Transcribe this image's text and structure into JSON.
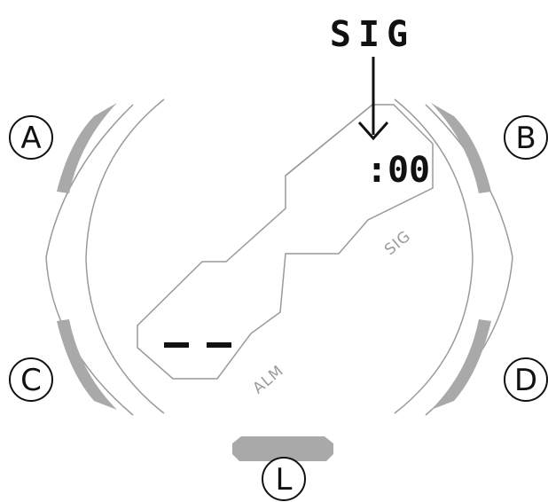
{
  "callout": {
    "label": "SIG"
  },
  "buttons": [
    {
      "id": "A",
      "letter": "A"
    },
    {
      "id": "B",
      "letter": "B"
    },
    {
      "id": "C",
      "letter": "C"
    },
    {
      "id": "D",
      "letter": "D"
    },
    {
      "id": "L",
      "letter": "L"
    }
  ],
  "display": {
    "upper_value": ":00",
    "upper_label": "SIG",
    "lower_value": "- -",
    "lower_label": "ALM"
  },
  "colors": {
    "outline": "#9a9a9a",
    "button_fill": "#a9a9a9",
    "ink": "#111111"
  }
}
